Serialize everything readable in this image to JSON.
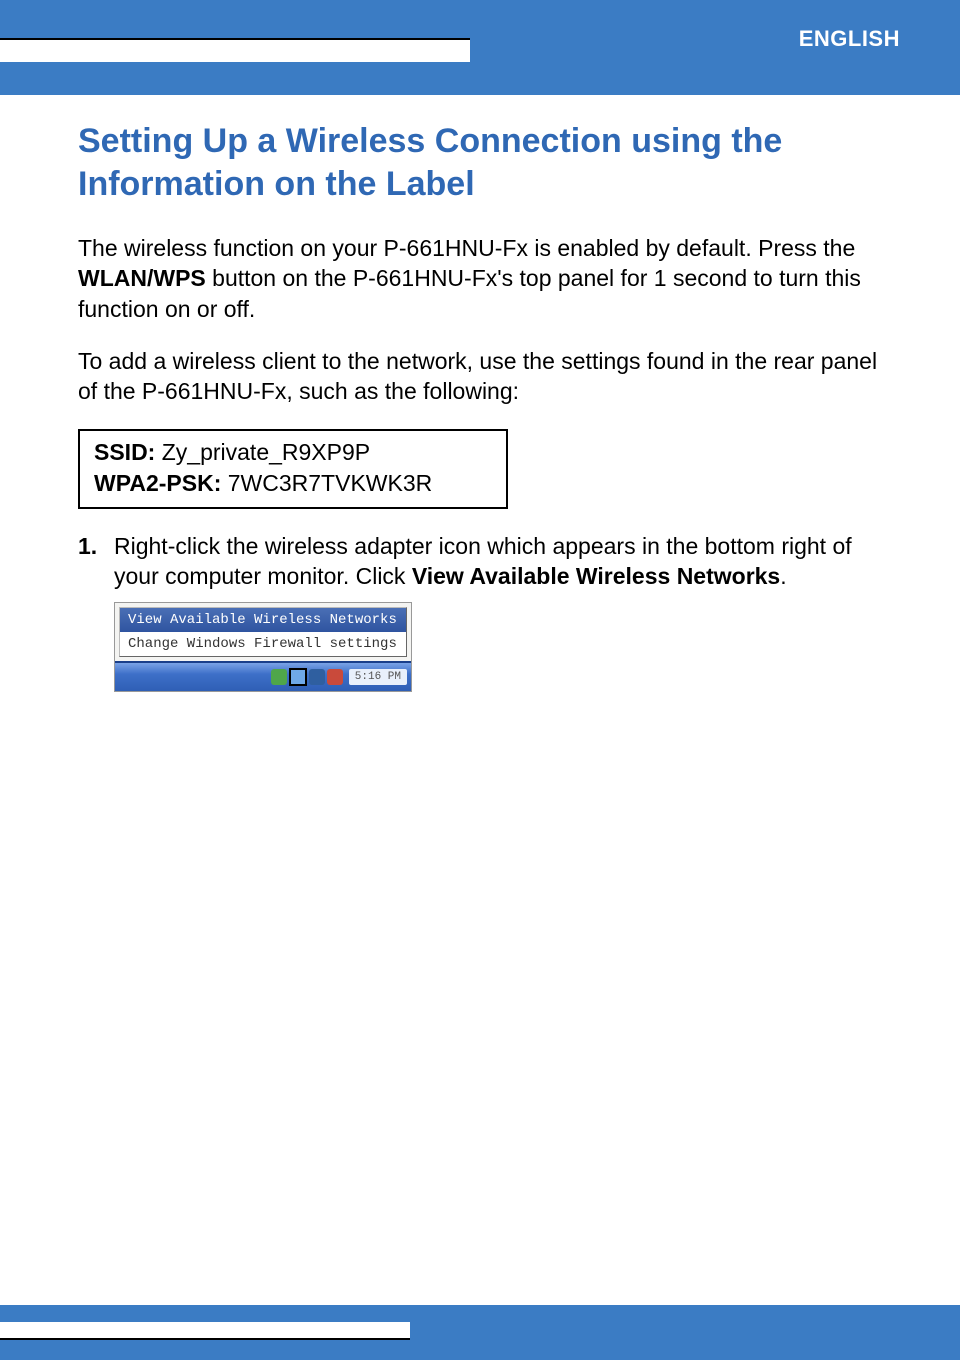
{
  "header": {
    "language": "ENGLISH"
  },
  "title": "Setting Up a Wireless Connection using the Information on the Label",
  "para1": {
    "pre": "The wireless function on your P-661HNU-Fx is enabled by default. Press the ",
    "bold": "WLAN/WPS",
    "post": " button on the P-661HNU-Fx's top panel for 1 second to turn this function on or off."
  },
  "para2": "To add a wireless client to the network, use the settings found in the rear panel of the P-661HNU-Fx, such as the following:",
  "label_box": {
    "ssid_label": "SSID:",
    "ssid_value": "Zy_private_R9XP9P",
    "psk_label": "WPA2-PSK:",
    "psk_value": "7WC3R7TVKWK3R"
  },
  "step1": {
    "num": "1.",
    "pre": "Right-click the wireless adapter icon which appears in the bottom right of your computer monitor. Click ",
    "bold": "View Available Wireless Networks",
    "post": "."
  },
  "screenshot": {
    "menu_item_selected": "View Available Wireless Networks",
    "menu_item_2": "Change Windows Firewall settings",
    "taskbar_time": "5:16 PM"
  }
}
